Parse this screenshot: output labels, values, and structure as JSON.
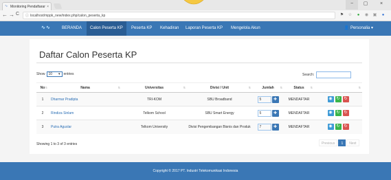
{
  "browser": {
    "tab_title": "Monitoring Pendaftaran",
    "url": "localhost/mppk_new/index.php/calon_peserta_kp",
    "close_glyph": "×",
    "minimize_glyph": "−",
    "maximize_glyph": "▢",
    "back_glyph": "←",
    "forward_glyph": "→",
    "reload_glyph": "C",
    "secure_glyph": "ⓘ"
  },
  "navbar": {
    "brand": "∿∿",
    "items": [
      {
        "label": "BERANDA"
      },
      {
        "label": "Calon Peserta KP"
      },
      {
        "label": "Peserta KP"
      },
      {
        "label": "Kehadiran"
      },
      {
        "label": "Laporan Peserta KP"
      },
      {
        "label": "Mengelola Akun"
      }
    ],
    "user_menu": "👤 Personalia ▾"
  },
  "page": {
    "title": "Daftar Calon Peserta KP",
    "show_label": "Show",
    "entries_value": "10",
    "entries_label": "entries",
    "search_label": "Search:"
  },
  "table": {
    "headers": [
      "No",
      "Nama",
      "Universitas",
      "Divisi / Unit",
      "Jumlah",
      "Status",
      ""
    ],
    "rows": [
      {
        "no": "1",
        "nama": "Dharmar Pradipta",
        "universitas": "TRI-KOM",
        "divisi": "SBU Broadband",
        "jumlah": "5",
        "status": "MENDAFTAR"
      },
      {
        "no": "2",
        "nama": "Rindiza Sinlam",
        "universitas": "Telkom School",
        "divisi": "SBU Smart Energy",
        "jumlah": "5",
        "status": "MENDAFTAR"
      },
      {
        "no": "3",
        "nama": "Putra Aguslar",
        "universitas": "Telkom University",
        "divisi": "Divisi Pengembangan Bisnis dan Produk",
        "jumlah": "7",
        "status": "MENDAFTAR"
      }
    ],
    "save_glyph": "✚",
    "action_glyphs": {
      "view": "◉",
      "approve": "↻",
      "reject": "↻"
    }
  },
  "footer_info": {
    "showing": "Showing 1 to 3 of 3 entries",
    "previous": "Previous",
    "page": "1",
    "next": "Next"
  },
  "footer": {
    "copyright": "Copyright © 2017 PT. Industri Telekomunikasi Indonesia"
  },
  "colors": {
    "primary": "#3a77b5",
    "active_nav": "#2a5d94",
    "success": "#39b54a",
    "danger": "#d9534f",
    "info": "#3e9ad6"
  }
}
